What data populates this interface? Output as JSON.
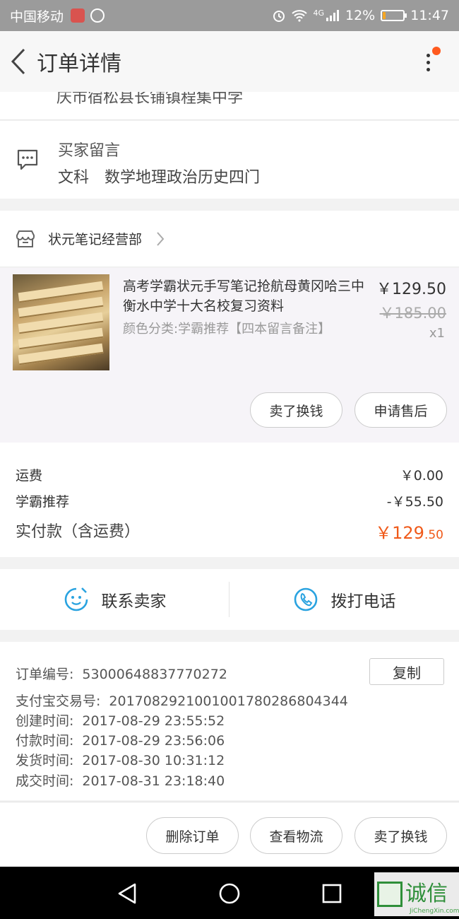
{
  "status_bar": {
    "carrier": "中国移动",
    "network": "4G",
    "battery": "12%",
    "battery_level": 0.12,
    "time": "11:47"
  },
  "header": {
    "title": "订单详情"
  },
  "address": {
    "fragment": "庆市宿松县长铺镇程集中学"
  },
  "buyer_message": {
    "label": "买家留言",
    "subject": "文科",
    "content": "数学地理政治历史四门"
  },
  "shop": {
    "name": "状元笔记经营部"
  },
  "item": {
    "title": "高考学霸状元手写笔记抢航母黄冈哈三中衡水中学十大名校复习资料",
    "spec": "颜色分类:学霸推荐【四本留言备注】",
    "price": "￥129.50",
    "original_price": "￥185.00",
    "quantity": "x1",
    "buttons": {
      "sell": "卖了换钱",
      "after_sale": "申请售后"
    }
  },
  "fees": {
    "shipping_label": "运费",
    "shipping_value": "￥0.00",
    "discount_label": "学霸推荐",
    "discount_value": "-￥55.50",
    "paid_label": "实付款（含运费）",
    "paid_main": "￥129",
    "paid_decimal": ".50"
  },
  "contact": {
    "seller": "联系卖家",
    "phone": "拨打电话"
  },
  "order_info": {
    "copy_button": "复制",
    "rows": [
      {
        "label": "订单编号:",
        "value": "53000648837770272"
      },
      {
        "label": "支付宝交易号:",
        "value": "2017082921001001780286804344"
      },
      {
        "label": "创建时间:",
        "value": "2017-08-29 23:55:52"
      },
      {
        "label": "付款时间:",
        "value": "2017-08-29 23:56:06"
      },
      {
        "label": "发货时间:",
        "value": "2017-08-30 10:31:12"
      },
      {
        "label": "成交时间:",
        "value": "2017-08-31 23:18:40"
      }
    ]
  },
  "actions": {
    "delete": "删除订单",
    "logistics": "查看物流",
    "sell": "卖了换钱"
  },
  "watermark": {
    "text": "诚信",
    "sub": "JiChengXin.com"
  },
  "colors": {
    "accent": "#f05a1a",
    "contact_icon": "#2aa3e0"
  }
}
